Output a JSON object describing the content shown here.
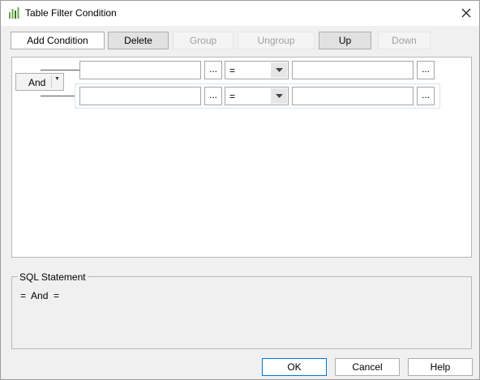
{
  "window": {
    "title": "Table Filter Condition"
  },
  "toolbar": {
    "add_condition": "Add Condition",
    "delete": "Delete",
    "group": "Group",
    "ungroup": "Ungroup",
    "up": "Up",
    "down": "Down"
  },
  "conditions": {
    "logic_operator": "And",
    "rows": [
      {
        "left_value": "",
        "operator": "=",
        "right_value": "",
        "browse": "..."
      },
      {
        "left_value": "",
        "operator": "=",
        "right_value": "",
        "browse": "..."
      }
    ]
  },
  "sql": {
    "label": "SQL Statement",
    "statement": "=  And  ="
  },
  "footer": {
    "ok": "OK",
    "cancel": "Cancel",
    "help": "Help"
  },
  "icons": {
    "app": "bar-chart-icon",
    "close": "close-icon",
    "dropdown": "chevron-down-icon"
  }
}
